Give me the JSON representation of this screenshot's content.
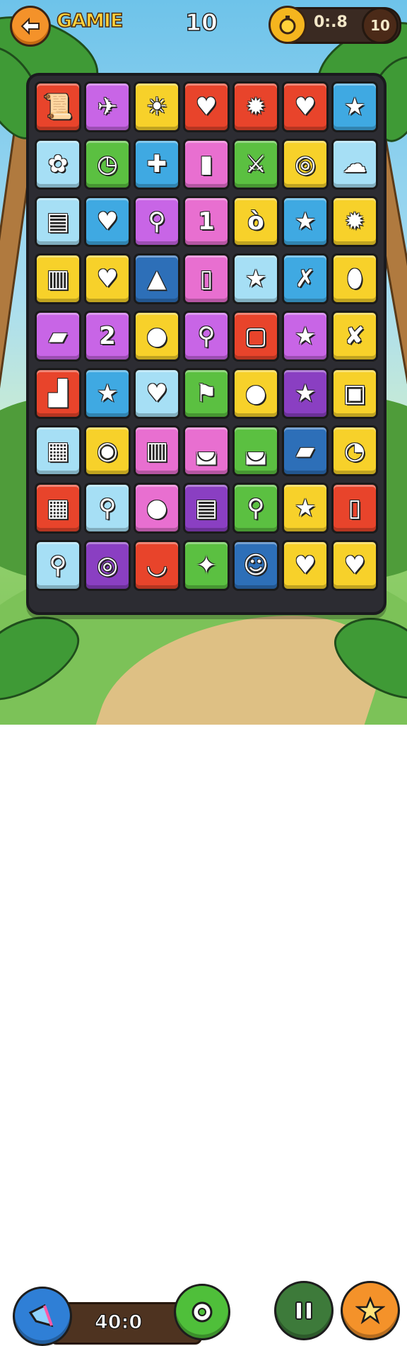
{
  "header": {
    "back_icon": "back-arrow-icon",
    "title": "GAMIE",
    "score": "10",
    "timer_icon": "stopwatch-icon",
    "timer": "0:.8",
    "coins": "10"
  },
  "board": {
    "columns": 7,
    "rows": 9,
    "tiles": [
      {
        "color": "#e8442b",
        "icon": "scroll-icon",
        "glyph": "📜"
      },
      {
        "color": "#c865e6",
        "icon": "paper-plane-icon",
        "glyph": "✈"
      },
      {
        "color": "#f7d12a",
        "icon": "sun-icon",
        "glyph": "☀"
      },
      {
        "color": "#e8442b",
        "icon": "heart-icon",
        "glyph": "♥"
      },
      {
        "color": "#e8442b",
        "icon": "blob-icon",
        "glyph": "✹"
      },
      {
        "color": "#e8442b",
        "icon": "heart-icon",
        "glyph": "♥"
      },
      {
        "color": "#3fa9e2",
        "icon": "star-icon",
        "glyph": "★"
      },
      {
        "color": "#a6dff5",
        "icon": "flower-icon",
        "glyph": "✿"
      },
      {
        "color": "#5bc041",
        "icon": "clock-icon",
        "glyph": "◷"
      },
      {
        "color": "#3fa9e2",
        "icon": "puzzle-piece-icon",
        "glyph": "✚"
      },
      {
        "color": "#e86fd0",
        "icon": "bottle-icon",
        "glyph": "▮"
      },
      {
        "color": "#5bc041",
        "icon": "sword-icon",
        "glyph": "⚔"
      },
      {
        "color": "#f7d12a",
        "icon": "lollipop-icon",
        "glyph": "◎"
      },
      {
        "color": "#a6dff5",
        "icon": "speech-bubble-icon",
        "glyph": "☁"
      },
      {
        "color": "#a6dff5",
        "icon": "trash-can-icon",
        "glyph": "▤"
      },
      {
        "color": "#3fa9e2",
        "icon": "heart-icon",
        "glyph": "♥"
      },
      {
        "color": "#c865e6",
        "icon": "magic-wand-icon",
        "glyph": "⚲"
      },
      {
        "color": "#e86fd0",
        "icon": "number-one-icon",
        "glyph": "1"
      },
      {
        "color": "#f7d12a",
        "icon": "bomb-icon",
        "glyph": "ò"
      },
      {
        "color": "#3fa9e2",
        "icon": "star-icon",
        "glyph": "★"
      },
      {
        "color": "#f7d12a",
        "icon": "gear-icon",
        "glyph": "✹"
      },
      {
        "color": "#f7d12a",
        "icon": "barrel-icon",
        "glyph": "▥"
      },
      {
        "color": "#f7d12a",
        "icon": "heart-icon",
        "glyph": "♥"
      },
      {
        "color": "#2d6fb8",
        "icon": "warning-triangle-icon",
        "glyph": "▲"
      },
      {
        "color": "#e86fd0",
        "icon": "cup-icon",
        "glyph": "▯"
      },
      {
        "color": "#a6dff5",
        "icon": "star-icon",
        "glyph": "★"
      },
      {
        "color": "#3fa9e2",
        "icon": "dagger-icon",
        "glyph": "✗"
      },
      {
        "color": "#f7d12a",
        "icon": "lemon-icon",
        "glyph": "⬮"
      },
      {
        "color": "#c865e6",
        "icon": "cheese-block-icon",
        "glyph": "▰"
      },
      {
        "color": "#c865e6",
        "icon": "number-two-icon",
        "glyph": "2"
      },
      {
        "color": "#f7d12a",
        "icon": "orange-icon",
        "glyph": "●"
      },
      {
        "color": "#c865e6",
        "icon": "magnifier-icon",
        "glyph": "⚲"
      },
      {
        "color": "#e8442b",
        "icon": "jar-icon",
        "glyph": "▢"
      },
      {
        "color": "#c865e6",
        "icon": "star-icon",
        "glyph": "★"
      },
      {
        "color": "#f7d12a",
        "icon": "cross-mark-icon",
        "glyph": "✘"
      },
      {
        "color": "#e8442b",
        "icon": "bread-icon",
        "glyph": "▟"
      },
      {
        "color": "#3fa9e2",
        "icon": "star-icon",
        "glyph": "★"
      },
      {
        "color": "#a6dff5",
        "icon": "heart-icon",
        "glyph": "♥"
      },
      {
        "color": "#5bc041",
        "icon": "flag-pin-icon",
        "glyph": "⚑"
      },
      {
        "color": "#f7d12a",
        "icon": "ball-icon",
        "glyph": "●"
      },
      {
        "color": "#8a3fc2",
        "icon": "star-icon",
        "glyph": "★"
      },
      {
        "color": "#f7d12a",
        "icon": "gift-box-icon",
        "glyph": "▣"
      },
      {
        "color": "#a6dff5",
        "icon": "honey-jar-icon",
        "glyph": "▦"
      },
      {
        "color": "#f7d12a",
        "icon": "donut-icon",
        "glyph": "◉"
      },
      {
        "color": "#e86fd0",
        "icon": "trash-bin-icon",
        "glyph": "▥"
      },
      {
        "color": "#e86fd0",
        "icon": "pot-icon",
        "glyph": "◛"
      },
      {
        "color": "#5bc041",
        "icon": "cooking-pot-icon",
        "glyph": "◛"
      },
      {
        "color": "#2d6fb8",
        "icon": "battery-icon",
        "glyph": "▰"
      },
      {
        "color": "#f7d12a",
        "icon": "pie-clock-icon",
        "glyph": "◔"
      },
      {
        "color": "#e8442b",
        "icon": "honey-jar-icon",
        "glyph": "▦"
      },
      {
        "color": "#a6dff5",
        "icon": "racket-icon",
        "glyph": "⚲"
      },
      {
        "color": "#e86fd0",
        "icon": "bomb-icon",
        "glyph": "●"
      },
      {
        "color": "#8a3fc2",
        "icon": "notepad-icon",
        "glyph": "▤"
      },
      {
        "color": "#5bc041",
        "icon": "magnifier-icon",
        "glyph": "⚲"
      },
      {
        "color": "#f7d12a",
        "icon": "star-icon",
        "glyph": "★"
      },
      {
        "color": "#e8442b",
        "icon": "mug-icon",
        "glyph": "▯"
      },
      {
        "color": "#a6dff5",
        "icon": "frying-pan-icon",
        "glyph": "⚲"
      },
      {
        "color": "#8a3fc2",
        "icon": "ring-icon",
        "glyph": "◎"
      },
      {
        "color": "#e8442b",
        "icon": "coconut-cup-icon",
        "glyph": "◡"
      },
      {
        "color": "#5bc041",
        "icon": "leaf-figure-icon",
        "glyph": "✦"
      },
      {
        "color": "#2d6fb8",
        "icon": "smiley-orange-icon",
        "glyph": "☺"
      },
      {
        "color": "#f7d12a",
        "icon": "heart-icon",
        "glyph": "♥"
      },
      {
        "color": "#f7d12a",
        "icon": "heart-icon",
        "glyph": "♥"
      }
    ]
  },
  "footer": {
    "megaphone_icon": "megaphone-icon",
    "bar_value": "40:0",
    "gear_icon": "settings-cog-icon",
    "pause_icon": "pause-icon",
    "star_icon": "star-icon"
  },
  "colors": {
    "brand_orange": "#f4922a",
    "title_yellow": "#ffd23a",
    "board_dark": "#2c2c32",
    "pause_green": "#3d7a3a",
    "cog_green": "#4fbf3a",
    "megaphone_blue": "#2f7fd6"
  }
}
